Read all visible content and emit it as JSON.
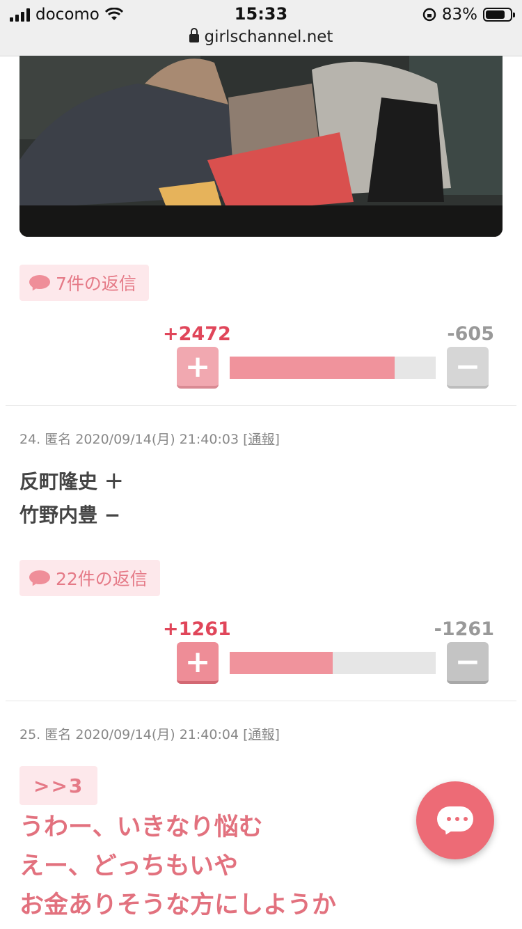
{
  "status_bar": {
    "carrier": "docomo",
    "time": "15:33",
    "battery_percent": "83%",
    "url": "girlschannel.net"
  },
  "comments": [
    {
      "reply_label": "7件の返信",
      "plus": "+2472",
      "minus": "-605",
      "plus_ratio": 0.8
    },
    {
      "number": "24.",
      "author": "匿名",
      "datetime": "2020/09/14(月) 21:40:03",
      "report": "[通報]",
      "lines": [
        "反町隆史 ＋",
        "竹野内豊 −"
      ],
      "reply_label": "22件の返信",
      "plus": "+1261",
      "minus": "-1261",
      "plus_ratio": 0.5
    },
    {
      "number": "25.",
      "author": "匿名",
      "datetime": "2020/09/14(月) 21:40:04",
      "report": "[通報]",
      "anchor": ">>3",
      "lines": [
        "うわー、いきなり悩む",
        "えー、どっちもいや",
        "お金ありそうな方にしようか"
      ]
    }
  ],
  "icons": {
    "plus_button": "+",
    "minus_button": "−"
  },
  "colors": {
    "accent": "#e0465a",
    "pink_text": "#e2717e",
    "bar_fill": "#f0939c"
  }
}
